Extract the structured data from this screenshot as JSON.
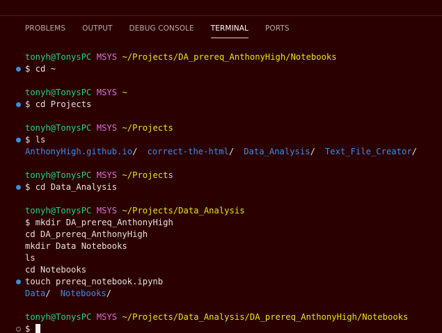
{
  "tabs": [
    {
      "label": "PROBLEMS"
    },
    {
      "label": "OUTPUT"
    },
    {
      "label": "DEBUG CONSOLE"
    },
    {
      "label": "TERMINAL"
    },
    {
      "label": "PORTS"
    }
  ],
  "prompt": {
    "user": "tonyh@TonysPC",
    "env": "MSYS",
    "sign": "$"
  },
  "blocks": [
    {
      "path": "~/Projects/DA_prereq_AnthonyHigh/Notebooks",
      "command": "cd ~"
    },
    {
      "path": "~",
      "command": "cd Projects"
    },
    {
      "path": "~/Projects",
      "command": "ls",
      "output_dirs": [
        "AnthonyHigh.github.io",
        "correct-the-html",
        "Data_Analysis",
        "Text_File_Creator"
      ]
    },
    {
      "path": "~/Projects",
      "command": "cd Data_Analysis"
    },
    {
      "path": "~/Projects/Data_Analysis",
      "commands": [
        "mkdir DA_prereq_AnthonyHigh",
        "cd DA_prereq_AnthonyHigh",
        "mkdir Data Notebooks",
        "ls",
        "cd Notebooks",
        "touch prereq_notebook.ipynb"
      ],
      "output_dirs": [
        "Data",
        "Notebooks"
      ]
    },
    {
      "path": "~/Projects/Data_Analysis/DA_prereq_AnthonyHigh/Notebooks"
    }
  ],
  "colors": {
    "background": "#2b0000",
    "user": "#23d18b",
    "env": "#d670d6",
    "path": "#e5e510",
    "dir": "#3b8eea",
    "decoration": "#3b8fd6"
  }
}
